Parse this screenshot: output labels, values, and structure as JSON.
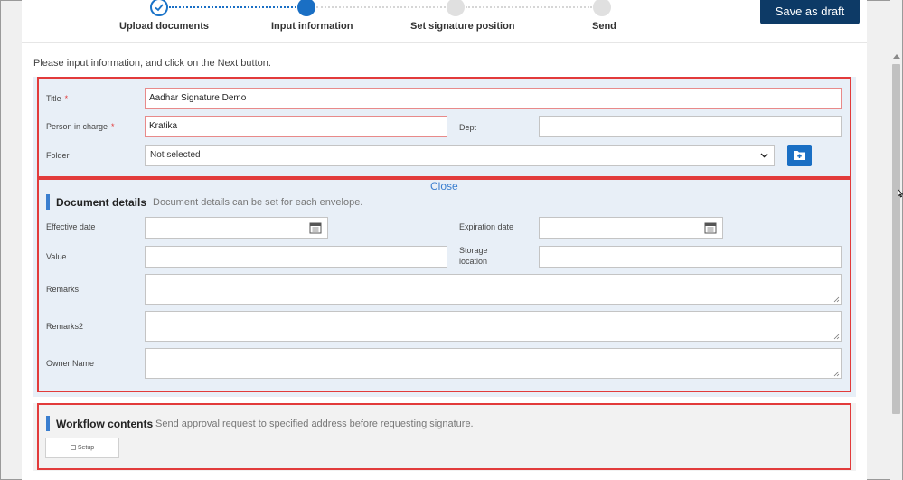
{
  "stepper": {
    "steps": [
      {
        "label": "Upload documents",
        "state": "done"
      },
      {
        "label": "Input information",
        "state": "current"
      },
      {
        "label": "Set signature position",
        "state": "todo"
      },
      {
        "label": "Send",
        "state": "todo"
      }
    ]
  },
  "toolbar": {
    "save_draft_label": "Save as draft"
  },
  "instruction": "Please input information, and click on the Next button.",
  "form": {
    "title": {
      "label": "Title",
      "required_mark": "*",
      "value": "Aadhar Signature Demo"
    },
    "person_in_charge": {
      "label": "Person in charge",
      "required_mark": "*",
      "value": "Kratika"
    },
    "dept": {
      "label": "Dept",
      "value": ""
    },
    "folder": {
      "label": "Folder",
      "selected": "Not selected"
    }
  },
  "document_details": {
    "close_label": "Close",
    "title": "Document details",
    "description": "Document details can be set for each envelope.",
    "effective_date": {
      "label": "Effective date",
      "value": ""
    },
    "expiration_date": {
      "label": "Expiration date",
      "value": ""
    },
    "value": {
      "label": "Value",
      "value": ""
    },
    "storage_location": {
      "label_line1": "Storage",
      "label_line2": "location",
      "value": ""
    },
    "remarks": {
      "label": "Remarks",
      "value": ""
    },
    "remarks2": {
      "label": "Remarks2",
      "value": ""
    },
    "owner_name": {
      "label": "Owner Name",
      "value": ""
    }
  },
  "workflow": {
    "title": "Workflow contents",
    "description": "Send approval request to specified address before requesting signature.",
    "setup_label": "Setup"
  },
  "colors": {
    "accent": "#1a6fc4",
    "draft_button": "#0d3a66",
    "highlight_border": "#e23b3b",
    "panel_blue": "#e8eff7"
  },
  "icons": [
    "check-icon",
    "calendar-icon",
    "folder-plus-icon",
    "chevron-down-icon",
    "resize-handle-icon",
    "mouse-cursor-icon"
  ]
}
